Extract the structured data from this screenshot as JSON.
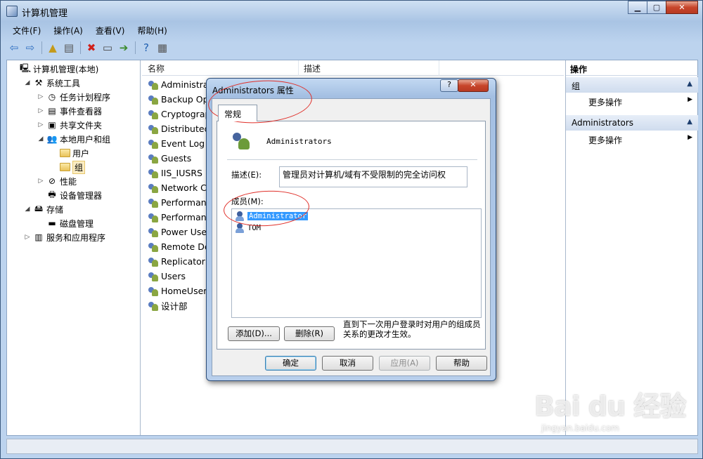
{
  "window": {
    "title": "计算机管理"
  },
  "menu": [
    "文件(F)",
    "操作(A)",
    "查看(V)",
    "帮助(H)"
  ],
  "toolbar": [
    {
      "icon": "back-arrow-icon",
      "glyph": "⇦",
      "color": "#2f6fc1"
    },
    {
      "icon": "forward-arrow-icon",
      "glyph": "⇨",
      "color": "#2f6fc1"
    },
    {
      "icon": "up-folder-icon",
      "glyph": "▲",
      "color": "#c49a1a"
    },
    {
      "icon": "show-hide-tree-icon",
      "glyph": "▤",
      "color": "#555555"
    },
    {
      "icon": "delete-icon",
      "glyph": "✖",
      "color": "#d0201a"
    },
    {
      "icon": "properties-icon",
      "glyph": "▭",
      "color": "#4a4a4a"
    },
    {
      "icon": "export-list-icon",
      "glyph": "➔",
      "color": "#3a8a2a"
    },
    {
      "icon": "help-icon",
      "glyph": "?",
      "color": "#1f5fb0"
    },
    {
      "icon": "view-pane-icon",
      "glyph": "▦",
      "color": "#555555"
    }
  ],
  "tree": [
    {
      "label": "计算机管理(本地)",
      "indent": 0,
      "twisty": "",
      "icon": "computer-icon",
      "glyph": "🖳"
    },
    {
      "label": "系统工具",
      "indent": 1,
      "twisty": "◢",
      "icon": "tools-icon",
      "glyph": "⚒"
    },
    {
      "label": "任务计划程序",
      "indent": 2,
      "twisty": "▷",
      "icon": "clock-icon",
      "glyph": "◷"
    },
    {
      "label": "事件查看器",
      "indent": 2,
      "twisty": "▷",
      "icon": "event-log-icon",
      "glyph": "▤"
    },
    {
      "label": "共享文件夹",
      "indent": 2,
      "twisty": "▷",
      "icon": "shared-folder-icon",
      "glyph": "▣"
    },
    {
      "label": "本地用户和组",
      "indent": 2,
      "twisty": "◢",
      "icon": "users-icon",
      "glyph": "👥"
    },
    {
      "label": "用户",
      "indent": 3,
      "twisty": "",
      "icon": "folder-icon",
      "glyph": ""
    },
    {
      "label": "组",
      "indent": 3,
      "twisty": "",
      "icon": "folder-icon",
      "glyph": "",
      "selected": true
    },
    {
      "label": "性能",
      "indent": 2,
      "twisty": "▷",
      "icon": "performance-icon",
      "glyph": "⊘"
    },
    {
      "label": "设备管理器",
      "indent": 2,
      "twisty": "",
      "icon": "device-manager-icon",
      "glyph": "🖶"
    },
    {
      "label": "存储",
      "indent": 1,
      "twisty": "◢",
      "icon": "storage-icon",
      "glyph": "🖴"
    },
    {
      "label": "磁盘管理",
      "indent": 2,
      "twisty": "",
      "icon": "disk-icon",
      "glyph": "▬"
    },
    {
      "label": "服务和应用程序",
      "indent": 1,
      "twisty": "▷",
      "icon": "services-icon",
      "glyph": "▥"
    }
  ],
  "list": {
    "columns": [
      "名称",
      "描述"
    ],
    "rows": [
      "Administrat",
      "Backup Ope",
      "Cryptograp",
      "Distributed",
      "Event Log R",
      "Guests",
      "IIS_IUSRS",
      "Network Co",
      "Performanc",
      "Performanc",
      "Power User",
      "Remote Des",
      "Replicator",
      "Users",
      "HomeUsers",
      "设计部"
    ]
  },
  "actions": {
    "title": "操作",
    "sections": [
      {
        "label": "组",
        "item": "更多操作"
      },
      {
        "label": "Administrators",
        "item": "更多操作"
      }
    ]
  },
  "dialog": {
    "title": "Administrators 属性",
    "help": "?",
    "close": "✕",
    "tab": "常规",
    "group_name": "Administrators",
    "desc_label": "描述(E):",
    "desc_value": "管理员对计算机/域有不受限制的完全访问权",
    "members_label": "成员(M):",
    "members": [
      {
        "name": "Administrator",
        "selected": true
      },
      {
        "name": "TOM",
        "selected": false
      }
    ],
    "add": "添加(D)...",
    "remove": "删除(R)",
    "note": "直到下一次用户登录时对用户的组成员关系的更改才生效。",
    "ok": "确定",
    "cancel": "取消",
    "apply": "应用(A)",
    "help_btn": "帮助"
  },
  "watermark": {
    "main": "Bai du 经验",
    "sub": "jingyan.baidu.com"
  }
}
